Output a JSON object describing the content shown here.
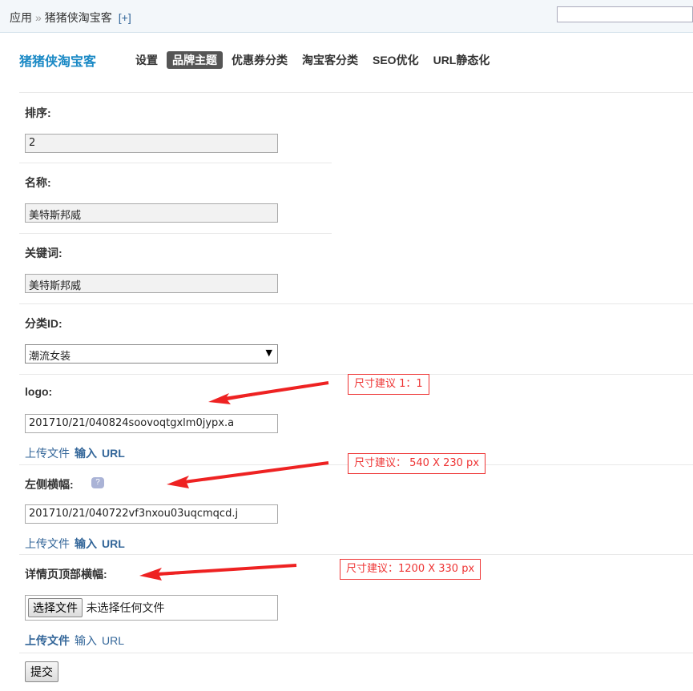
{
  "breadcrumb": {
    "root": "应用",
    "separator": "»",
    "current": "猪猪侠淘宝客",
    "add": "[+]"
  },
  "app_title": "猪猪侠淘宝客",
  "tabs": [
    {
      "label": "设置",
      "active": false
    },
    {
      "label": "品牌主题",
      "active": true
    },
    {
      "label": "优惠券分类",
      "active": false
    },
    {
      "label": "淘宝客分类",
      "active": false
    },
    {
      "label": "SEO优化",
      "active": false
    },
    {
      "label": "URL静态化",
      "active": false
    }
  ],
  "form": {
    "sort": {
      "label": "排序:",
      "value": "2"
    },
    "name": {
      "label": "名称:",
      "value": "美特斯邦威"
    },
    "keywords": {
      "label": "关键词:",
      "value": "美特斯邦威"
    },
    "category": {
      "label": "分类ID:",
      "selected": "潮流女装"
    },
    "logo": {
      "label": "logo:",
      "value": "201710/21/040824soovoqtgxlm0jypx.a",
      "upload": "上传文件",
      "input": "输入",
      "url": "URL",
      "hint": "尺寸建议 1：1"
    },
    "left_banner": {
      "label": "左侧横幅:",
      "help_icon": "?",
      "value": "201710/21/040722vf3nxou03uqcmqcd.j",
      "upload": "上传文件",
      "input": "输入",
      "url": "URL",
      "hint": "尺寸建议： 540 X 230 px"
    },
    "detail_banner": {
      "label": "详情页顶部横幅:",
      "choose_button": "选择文件",
      "no_file": "未选择任何文件",
      "upload": "上传文件",
      "input": "输入",
      "url": "URL",
      "hint": "尺寸建议：1200 X 330 px"
    },
    "submit": "提交"
  },
  "colors": {
    "accent": "#1a89c5",
    "link": "#336699",
    "annotation": "#ee3333",
    "active_tab": "#555555"
  }
}
